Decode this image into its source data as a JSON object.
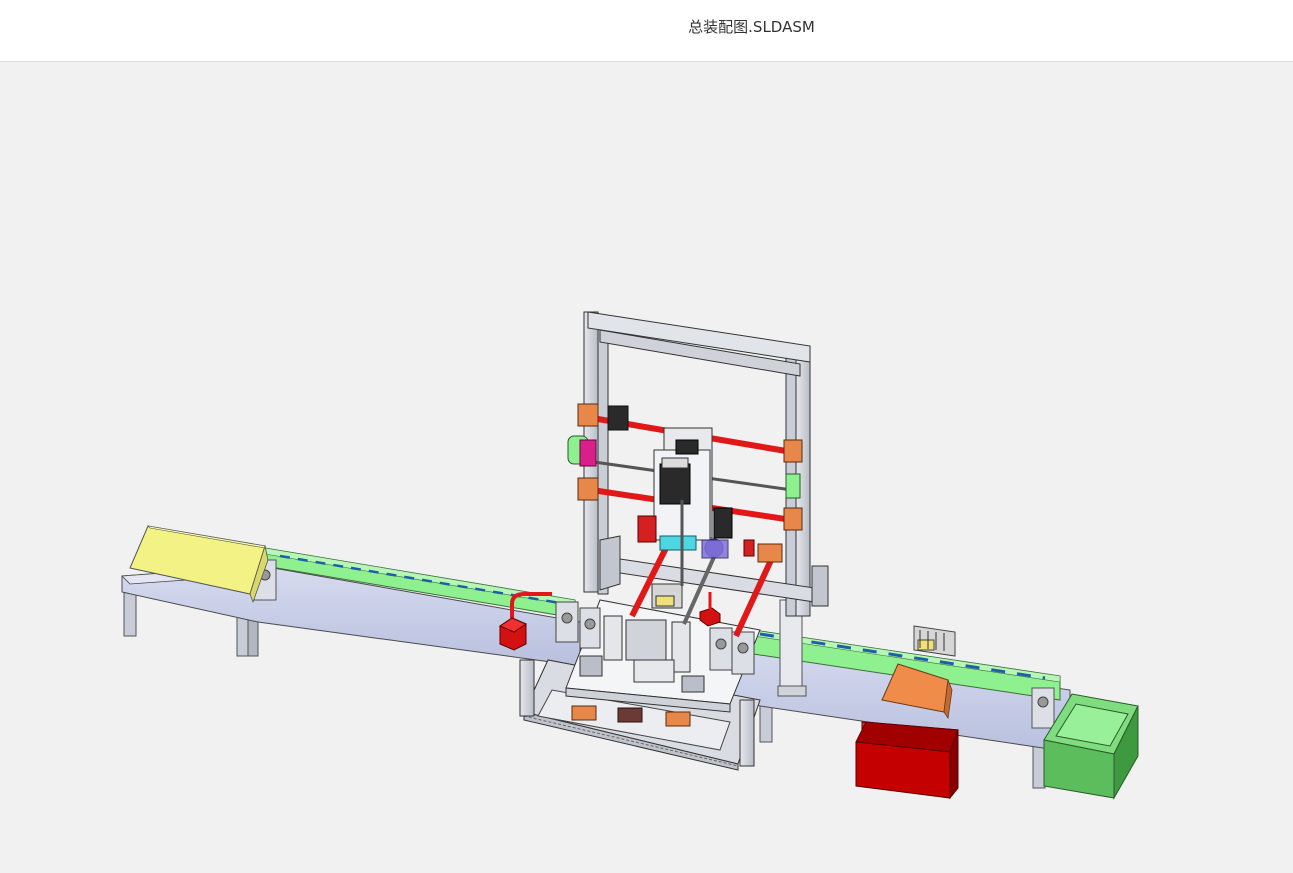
{
  "window": {
    "title": "总装配图.SLDASM"
  },
  "viewport": {
    "background": "#f1f1f1",
    "model_name": "assembly-conveyor-gantry"
  },
  "colors": {
    "frame": "#cfd3da",
    "frame_edge": "#4a4a4a",
    "table_top": "#c9cfe8",
    "belt_green": "#8ef08e",
    "belt_dash": "#1f5fa8",
    "rod_red": "#e01818",
    "bracket_orange": "#e7874a",
    "yellow_box": "#f2f285",
    "red_bin": "#c40000",
    "green_bin": "#5cbd5c",
    "orange_plate": "#f08c4a",
    "magenta": "#d81f8a",
    "cyan": "#4fd6e3",
    "blue_purple": "#6a5cc8"
  }
}
